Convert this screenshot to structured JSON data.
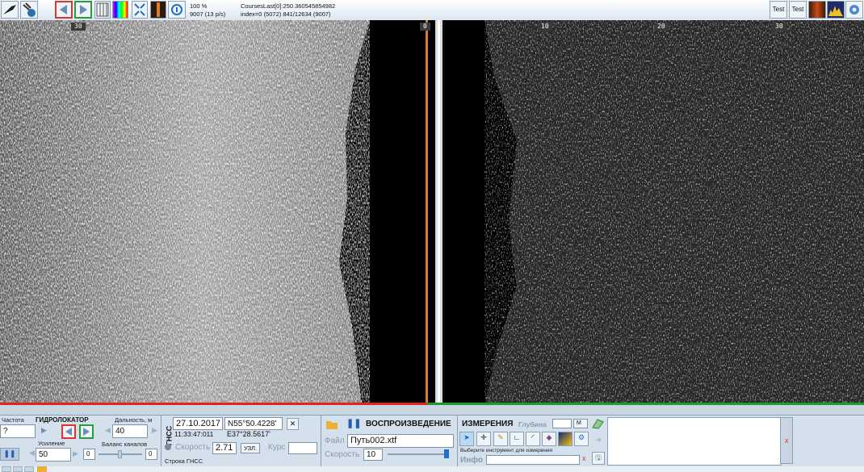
{
  "toolbar": {
    "zoom": "100 %",
    "rate": "9007 (13 p/s)",
    "course": "CoursesLast[0]:250.360545854982",
    "index": "index=0   (5072) 841/12634 (9007)",
    "test2": "Test 2",
    "test1": "Test 1"
  },
  "ruler": {
    "left_30": "30",
    "center_0": "0",
    "right_10": "10",
    "right_20": "20",
    "right_30": "30"
  },
  "sonar_panel": {
    "freq_label": "Частота",
    "freq_value": "?",
    "title": "ГИДРОЛОКАТОР",
    "range_label": "Дальность, м",
    "range_value": "40",
    "gain_label": "Усиление",
    "gain_value": "50",
    "balance_label": "Баланс каналов",
    "balance_left": "0",
    "balance_right": "0"
  },
  "gnss": {
    "title": "ГНСС",
    "date": "27.10.2017",
    "time": "11:33:47:011",
    "lat": "N55°50.4228'",
    "lon": "E37°28.5617'",
    "speed_label": "Скорость",
    "speed_value": "2.71",
    "speed_unit": "УЗЛ.",
    "course_label": "Курс",
    "course_value": "",
    "line_label": "Строка ГНСС"
  },
  "playback": {
    "title": "ВОСПРОИЗВЕДЕНИЕ",
    "file_label": "Файл",
    "file_value": "Путь002.xtf",
    "speed_label": "Скорость",
    "speed_value": "10"
  },
  "measure": {
    "title": "ИЗМЕРЕНИЯ",
    "depth_label": "Глубина",
    "depth_unit": "М",
    "hint": "Выберите инструмент для измерения",
    "info_label": "Инфо",
    "close": "x"
  },
  "side": {
    "close": "x"
  },
  "colors": {
    "port_line": "#e32222",
    "starboard_line": "#1f9a2d",
    "nadir": "#e07b22",
    "panel_bg": "#d4e1ed"
  }
}
